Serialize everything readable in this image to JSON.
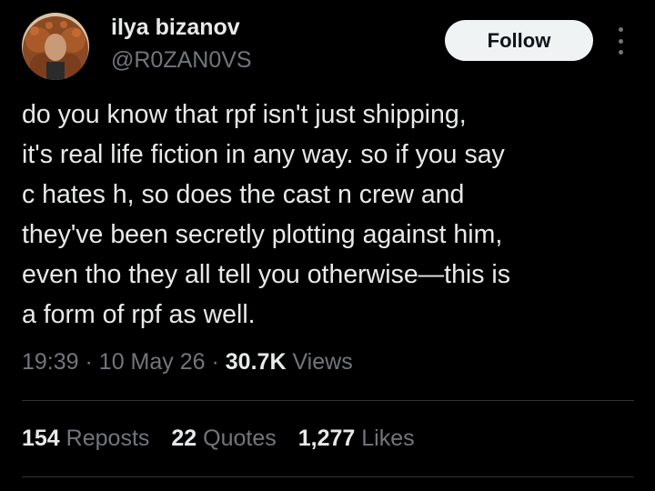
{
  "author": {
    "display_name": "ilya bizanov",
    "handle": "@R0ZAN0VS"
  },
  "follow_label": "Follow",
  "more_icon": "more-vertical-icon",
  "tweet": {
    "lines": [
      "do you know that rpf isn't just shipping,",
      "it's real life fiction in any way. so if you say",
      "c hates h, so does the cast n crew and",
      "they've been secretly plotting against him,",
      "even tho they all tell you otherwise—this is",
      "a form of rpf as well."
    ]
  },
  "meta": {
    "time": "19:39",
    "separator": "·",
    "date": "10 May 26",
    "views_count": "30.7K",
    "views_label": "Views"
  },
  "stats": {
    "reposts_count": "154",
    "reposts_label": "Reposts",
    "quotes_count": "22",
    "quotes_label": "Quotes",
    "likes_count": "1,277",
    "likes_label": "Likes"
  },
  "colors": {
    "background": "#000000",
    "primary_text": "#e7e9ea",
    "secondary_text": "#71767b",
    "button_bg": "#eff3f4",
    "divider": "#2f3336"
  }
}
